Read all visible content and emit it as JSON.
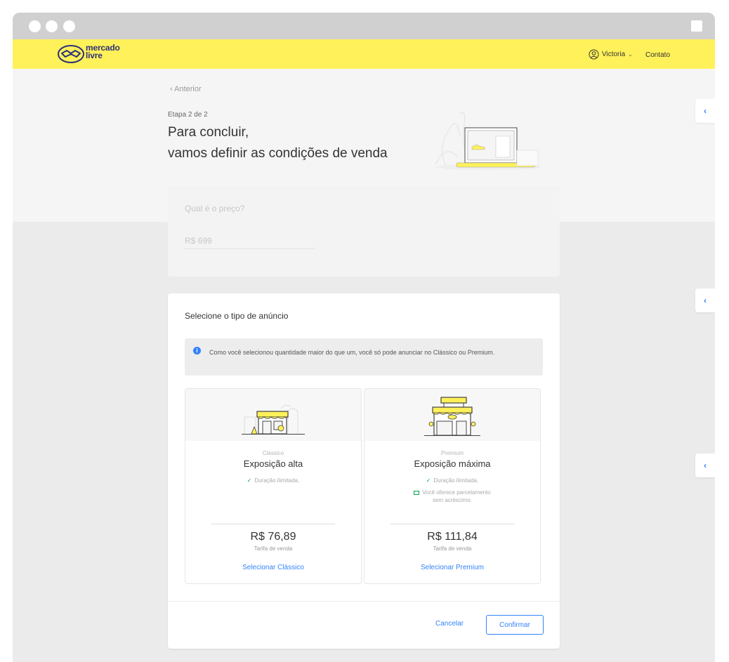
{
  "header": {
    "logo": {
      "line1": "mercado",
      "line2": "livre",
      "icon": "handshake-logo-icon"
    },
    "user_name": "Victoria",
    "contact_label": "Contato"
  },
  "page": {
    "back_label": "Anterior",
    "step_label": "Etapa 2 de 2",
    "title_line1": "Para concluir,",
    "title_line2": "vamos definir as condições de venda"
  },
  "price": {
    "question": "Qual é o preço?",
    "value": "R$ 699"
  },
  "listing_type": {
    "title": "Selecione o tipo de anúncio",
    "info_text": "Como você selecionou quantidade maior do que um, você só pode anunciar no Clássico ou Premium.",
    "options": [
      {
        "kicker": "Clássico",
        "name": "Exposição alta",
        "features": [
          "Duração ilimitada."
        ],
        "price": "R$ 76,89",
        "price_caption": "Tarifa de venda",
        "link_label": "Selecionar Clássico"
      },
      {
        "kicker": "Premium",
        "name": "Exposição máxima",
        "features": [
          "Duração ilimitada.",
          "Você oferece parcelamento",
          "sem acréscimo."
        ],
        "price": "R$ 111,84",
        "price_caption": "Tarifa de venda",
        "link_label": "Selecionar Premium"
      }
    ],
    "cancel_label": "Cancelar",
    "confirm_label": "Confirmar"
  },
  "colors": {
    "brand_yellow": "#fff159",
    "brand_blue": "#2d3277",
    "link_blue": "#3483fa",
    "success_green": "#00a650"
  }
}
